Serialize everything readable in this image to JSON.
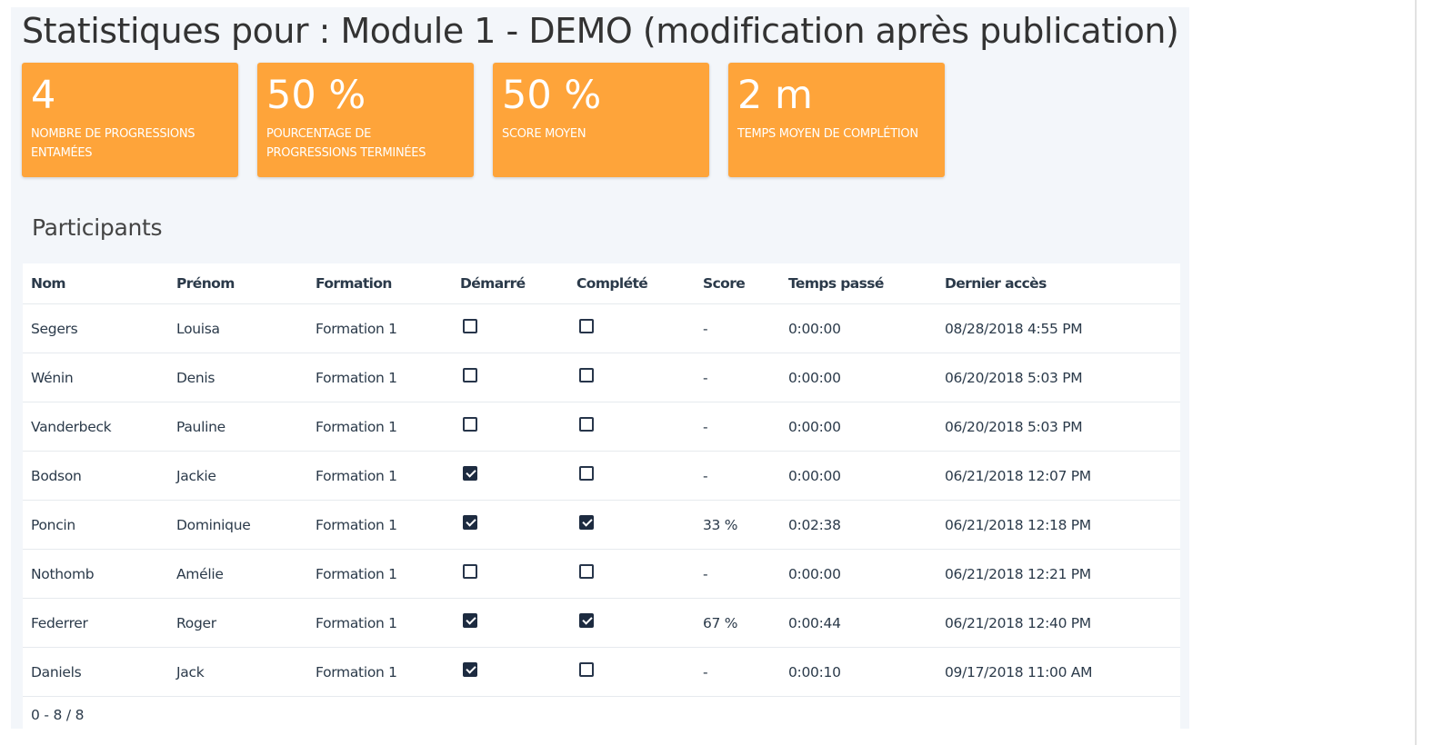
{
  "page_title": "Statistiques pour : Module 1 - DEMO (modification après publication)",
  "stats": [
    {
      "value": "4",
      "label": "NOMBRE DE PROGRESSIONS ENTAMÉES"
    },
    {
      "value": "50 %",
      "label": "POURCENTAGE DE PROGRESSIONS TERMINÉES"
    },
    {
      "value": "50 %",
      "label": "SCORE MOYEN"
    },
    {
      "value": "2 m",
      "label": "TEMPS MOYEN DE COMPLÉTION"
    }
  ],
  "participants": {
    "title": "Participants",
    "columns": {
      "nom": "Nom",
      "prenom": "Prénom",
      "formation": "Formation",
      "demarre": "Démarré",
      "complete": "Complété",
      "score": "Score",
      "temps": "Temps passé",
      "acces": "Dernier accès"
    },
    "rows": [
      {
        "nom": "Segers",
        "prenom": "Louisa",
        "formation": "Formation 1",
        "demarre": false,
        "complete": false,
        "score": "-",
        "temps": "0:00:00",
        "acces": "08/28/2018 4:55 PM"
      },
      {
        "nom": "Wénin",
        "prenom": "Denis",
        "formation": "Formation 1",
        "demarre": false,
        "complete": false,
        "score": "-",
        "temps": "0:00:00",
        "acces": "06/20/2018 5:03 PM"
      },
      {
        "nom": "Vanderbeck",
        "prenom": "Pauline",
        "formation": "Formation 1",
        "demarre": false,
        "complete": false,
        "score": "-",
        "temps": "0:00:00",
        "acces": "06/20/2018 5:03 PM"
      },
      {
        "nom": "Bodson",
        "prenom": "Jackie",
        "formation": "Formation 1",
        "demarre": true,
        "complete": false,
        "score": "-",
        "temps": "0:00:00",
        "acces": "06/21/2018 12:07 PM"
      },
      {
        "nom": "Poncin",
        "prenom": "Dominique",
        "formation": "Formation 1",
        "demarre": true,
        "complete": true,
        "score": "33 %",
        "temps": "0:02:38",
        "acces": "06/21/2018 12:18 PM"
      },
      {
        "nom": "Nothomb",
        "prenom": "Amélie",
        "formation": "Formation 1",
        "demarre": false,
        "complete": false,
        "score": "-",
        "temps": "0:00:00",
        "acces": "06/21/2018 12:21 PM"
      },
      {
        "nom": "Federrer",
        "prenom": "Roger",
        "formation": "Formation 1",
        "demarre": true,
        "complete": true,
        "score": "67 %",
        "temps": "0:00:44",
        "acces": "06/21/2018 12:40 PM"
      },
      {
        "nom": "Daniels",
        "prenom": "Jack",
        "formation": "Formation 1",
        "demarre": true,
        "complete": false,
        "score": "-",
        "temps": "0:00:10",
        "acces": "09/17/2018 11:00 AM"
      }
    ],
    "pagination": "0 - 8 / 8"
  },
  "colors": {
    "card_accent": "#fea43a",
    "panel_bg": "#f3f6fa",
    "checkbox": "#1d2b40"
  }
}
